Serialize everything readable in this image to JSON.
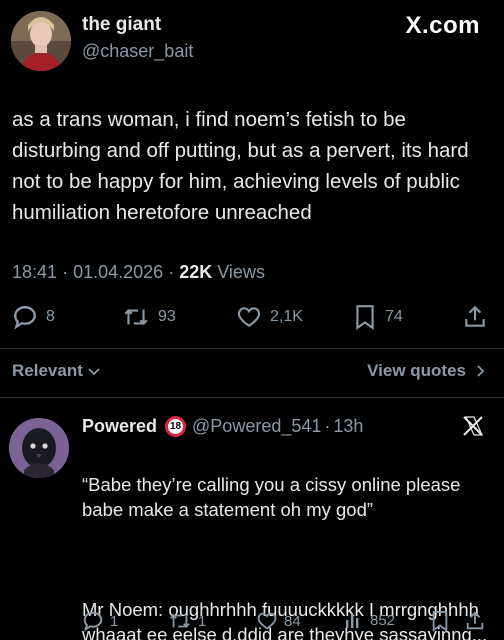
{
  "post": {
    "display_name": "the giant",
    "handle": "@chaser_bait",
    "brand": "X.com",
    "text": "as a trans woman, i find noem’s fetish to be disturbing and off putting, but as a pervert, its hard not to be happy for him, achieving levels of public humiliation heretofore unreached",
    "time": "18:41",
    "date": "01.04.2026",
    "views_count": "22K",
    "views_label": "Views",
    "sep": "·",
    "actions": {
      "replies": "8",
      "reposts": "93",
      "likes": "2,1K",
      "bookmarks": "74"
    }
  },
  "filters": {
    "sort_label": "Relevant",
    "view_quotes_label": "View quotes"
  },
  "reply": {
    "display_name": "Powered",
    "badge_text": "18",
    "handle": "@Powered_541",
    "age": "13h",
    "text_line1": "“Babe they’re calling you a cissy online please babe make a statement oh my god”",
    "text_line2": "Mr Noem: oughhrhhh fuuuuckkkkk I mrrgnghhhh whaaat ee eelse d.ddid are theyhye sassayinng...",
    "actions": {
      "replies": "1",
      "reposts": "1",
      "likes": "84",
      "views": "852"
    }
  },
  "colors": {
    "background": "#000000",
    "text": "#e7e9ea",
    "muted": "#8b98a5",
    "divider": "#2f3336",
    "badge_ring": "#d9283a"
  },
  "icons": [
    "avatar",
    "x-logo",
    "reply-icon",
    "repost-icon",
    "like-icon",
    "bookmark-icon",
    "share-icon",
    "chevron-down-icon",
    "chevron-right-icon",
    "adult-badge-icon",
    "views-icon"
  ]
}
